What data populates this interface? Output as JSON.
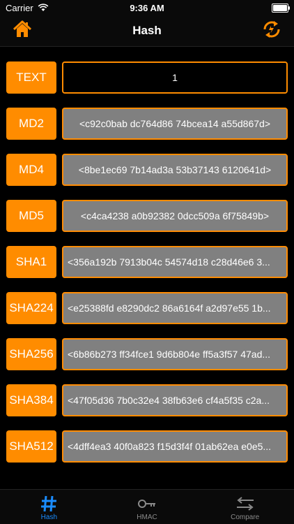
{
  "status": {
    "carrier": "Carrier",
    "time": "9:36 AM"
  },
  "navbar": {
    "title": "Hash"
  },
  "accent": "#ff8c00",
  "rows": [
    {
      "label": "TEXT",
      "value": "1",
      "kind": "input"
    },
    {
      "label": "MD2",
      "value": "<c92c0bab dc764d86 74bcea14 a55d867d>"
    },
    {
      "label": "MD4",
      "value": "<8be1ec69 7b14ad3a 53b37143 6120641d>"
    },
    {
      "label": "MD5",
      "value": "<c4ca4238 a0b92382 0dcc509a 6f75849b>"
    },
    {
      "label": "SHA1",
      "value": "<356a192b 7913b04c 54574d18 c28d46e6 3..."
    },
    {
      "label": "SHA224",
      "value": "<e25388fd e8290dc2 86a6164f a2d97e55 1b..."
    },
    {
      "label": "SHA256",
      "value": "<6b86b273 ff34fce1 9d6b804e ff5a3f57 47ad..."
    },
    {
      "label": "SHA384",
      "value": "<47f05d36 7b0c32e4 38fb63e6 cf4a5f35 c2a..."
    },
    {
      "label": "SHA512",
      "value": "<4dff4ea3 40f0a823 f15d3f4f 01ab62ea e0e5..."
    }
  ],
  "tabs": [
    {
      "label": "Hash",
      "icon": "hash-icon",
      "active": true
    },
    {
      "label": "HMAC",
      "icon": "key-icon",
      "active": false
    },
    {
      "label": "Compare",
      "icon": "compare-arrows-icon",
      "active": false
    }
  ]
}
